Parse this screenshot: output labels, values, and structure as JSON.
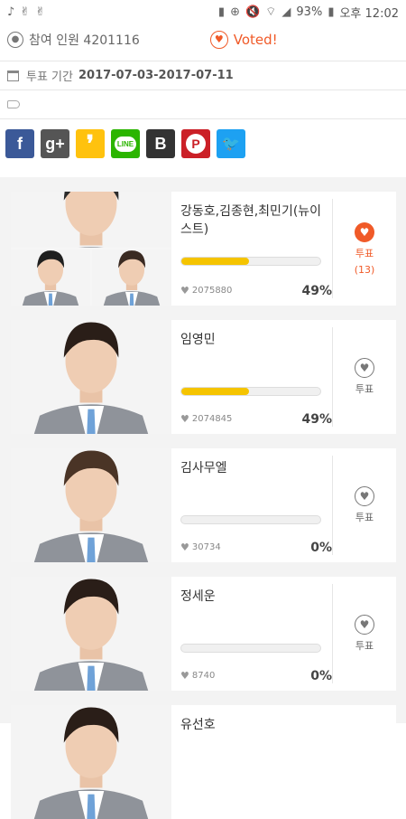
{
  "status_bar": {
    "left_icons": [
      "music-note-icon",
      "victory-hand-icon",
      "victory-hand-icon"
    ],
    "right_icons": [
      "sd-card-icon",
      "data-saver-icon",
      "mute-icon",
      "wifi-icon",
      "signal-icon",
      "battery-icon"
    ],
    "battery": "93%",
    "time": "오후 12:02"
  },
  "poll": {
    "participants": "참여 인원 4201116",
    "voted_label": "Voted!",
    "period_label": "투표 기간",
    "period_value": "2017-07-03-2017-07-11"
  },
  "share_buttons": [
    {
      "name": "facebook",
      "glyph": "f",
      "color": "#3b5998"
    },
    {
      "name": "google-plus",
      "glyph": "g+",
      "color": "#555555"
    },
    {
      "name": "kakaostory",
      "glyph": "❜",
      "color": "#ffc20e"
    },
    {
      "name": "line",
      "glyph": "LINE",
      "color": "#2bb500"
    },
    {
      "name": "band",
      "glyph": "B",
      "color": "#333333"
    },
    {
      "name": "pinterest",
      "glyph": "P",
      "color": "#cb2027"
    },
    {
      "name": "twitter",
      "glyph": "🐦",
      "color": "#1da1f2"
    }
  ],
  "candidates": [
    {
      "name": "강동호,김종현,최민기(뉴이스트)",
      "count": "2075880",
      "percent": "49%",
      "fill": 0.49,
      "voted": true,
      "vote_label": "투표",
      "vote_count": "(13)"
    },
    {
      "name": "임영민",
      "count": "2074845",
      "percent": "49%",
      "fill": 0.49,
      "voted": false,
      "vote_label": "투표",
      "vote_count": ""
    },
    {
      "name": "김사무엘",
      "count": "30734",
      "percent": "0%",
      "fill": 0.0,
      "voted": false,
      "vote_label": "투표",
      "vote_count": ""
    },
    {
      "name": "정세운",
      "count": "8740",
      "percent": "0%",
      "fill": 0.0,
      "voted": false,
      "vote_label": "투표",
      "vote_count": ""
    },
    {
      "name": "유선호",
      "count": "",
      "percent": "",
      "fill": 0.0,
      "voted": false,
      "vote_label": "",
      "vote_count": ""
    }
  ]
}
